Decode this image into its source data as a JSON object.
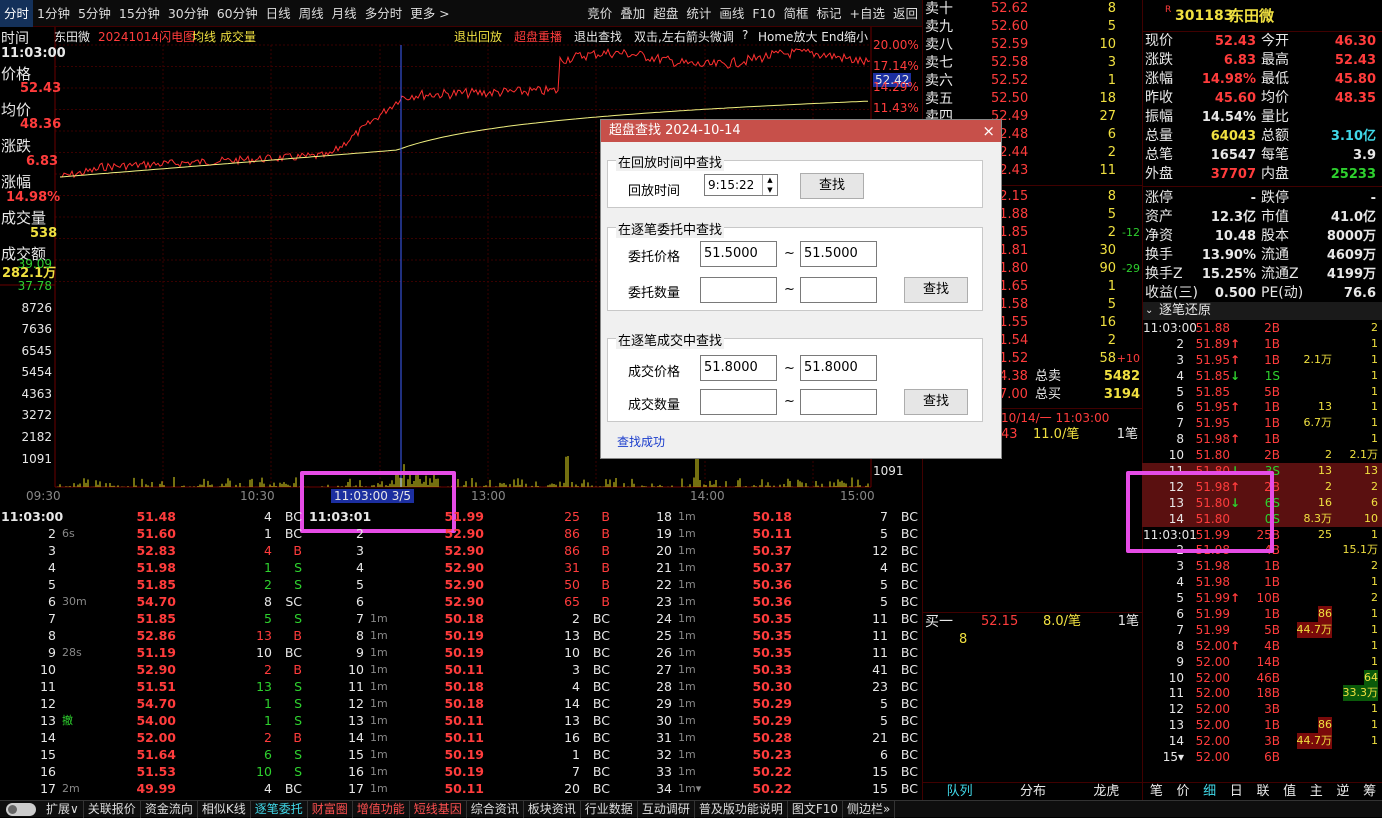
{
  "topbar": {
    "left": [
      "分时",
      "1分钟",
      "5分钟",
      "15分钟",
      "30分钟",
      "60分钟",
      "日线",
      "周线",
      "月线",
      "多分时",
      "更多 >"
    ],
    "right": [
      "竞价",
      "叠加",
      "超盘",
      "统计",
      "画线",
      "F10",
      "简框",
      "标记",
      "+自选",
      "返回"
    ]
  },
  "chart": {
    "name": "东田微",
    "title_date": "20241014闪电图",
    "legend": [
      "均线",
      "成交量"
    ],
    "actions": [
      "退出回放",
      "超盘重播",
      "退出查找",
      "双击,左右箭头微调",
      "?",
      "Home放大 End缩小"
    ],
    "side": {
      "time_label": "时间",
      "time": "11:03:00",
      "price_label": "价格",
      "price": "52.43",
      "avg_label": "均价",
      "avg": "48.36",
      "chg_label": "涨跌",
      "chg": "6.83",
      "pct_label": "涨幅",
      "pct": "14.98%",
      "vol_label": "成交量",
      "vol": "538",
      "amt_label": "成交额",
      "amt": "282.1万"
    },
    "left_axis": [
      "39.09",
      "37.78",
      "8726",
      "7636",
      "6545",
      "5454",
      "4363",
      "3272",
      "2182",
      "1091"
    ],
    "right_axis": [
      "20.00%",
      "17.14%",
      "52.42",
      "14.29%",
      "11.43%"
    ],
    "vol_right": "1091",
    "x_ticks": [
      "09:30",
      "10:30",
      "13:00",
      "14:00",
      "15:00"
    ],
    "cursor_label": "11:03:00 3/5",
    "colors": {
      "price": "#ff3030",
      "avg": "#f0f080",
      "vol": "#e8e020",
      "cursor": "#4060ff"
    }
  },
  "trades": {
    "col1": [
      [
        "11:03:00",
        "",
        "51.48",
        "4",
        "BC"
      ],
      [
        "2",
        "6s",
        "51.60",
        "1",
        "BC"
      ],
      [
        "3",
        "",
        "52.83",
        "4",
        "B"
      ],
      [
        "4",
        "",
        "51.98",
        "1",
        "S"
      ],
      [
        "5",
        "",
        "51.85",
        "2",
        "S"
      ],
      [
        "6",
        "30m",
        "54.70",
        "8",
        "SC"
      ],
      [
        "7",
        "",
        "51.85",
        "5",
        "S"
      ],
      [
        "8",
        "",
        "52.86",
        "13",
        "B"
      ],
      [
        "9",
        "28s",
        "51.19",
        "10",
        "BC"
      ],
      [
        "10",
        "",
        "52.90",
        "2",
        "B"
      ],
      [
        "11",
        "",
        "51.51",
        "13",
        "S"
      ],
      [
        "12",
        "",
        "54.70",
        "1",
        "S"
      ],
      [
        "13",
        "撤",
        "54.00",
        "1",
        "S"
      ],
      [
        "14",
        "",
        "52.00",
        "2",
        "B"
      ],
      [
        "15",
        "",
        "51.64",
        "6",
        "S"
      ],
      [
        "16",
        "",
        "51.53",
        "10",
        "S"
      ],
      [
        "17",
        "2m",
        "49.99",
        "4",
        "BC"
      ]
    ],
    "col2": [
      [
        "11:03:01",
        "",
        "51.99",
        "25",
        "B"
      ],
      [
        "2",
        "",
        "52.90",
        "86",
        "B"
      ],
      [
        "3",
        "",
        "52.90",
        "86",
        "B"
      ],
      [
        "4",
        "",
        "52.90",
        "31",
        "B"
      ],
      [
        "5",
        "",
        "52.90",
        "50",
        "B"
      ],
      [
        "6",
        "",
        "52.90",
        "65",
        "B"
      ],
      [
        "7",
        "1m",
        "50.18",
        "2",
        "BC"
      ],
      [
        "8",
        "1m",
        "50.19",
        "13",
        "BC"
      ],
      [
        "9",
        "1m",
        "50.19",
        "10",
        "BC"
      ],
      [
        "10",
        "1m",
        "50.11",
        "3",
        "BC"
      ],
      [
        "11",
        "1m",
        "50.18",
        "4",
        "BC"
      ],
      [
        "12",
        "1m",
        "50.18",
        "14",
        "BC"
      ],
      [
        "13",
        "1m",
        "50.11",
        "13",
        "BC"
      ],
      [
        "14",
        "1m",
        "50.11",
        "16",
        "BC"
      ],
      [
        "15",
        "1m",
        "50.19",
        "1",
        "BC"
      ],
      [
        "16",
        "1m",
        "50.19",
        "7",
        "BC"
      ],
      [
        "17",
        "1m",
        "50.11",
        "20",
        "BC"
      ]
    ],
    "col3": [
      [
        "18",
        "1m",
        "50.18",
        "7",
        "BC"
      ],
      [
        "19",
        "1m",
        "50.11",
        "5",
        "BC"
      ],
      [
        "20",
        "1m",
        "50.37",
        "12",
        "BC"
      ],
      [
        "21",
        "1m",
        "50.37",
        "4",
        "BC"
      ],
      [
        "22",
        "1m",
        "50.36",
        "5",
        "BC"
      ],
      [
        "23",
        "1m",
        "50.36",
        "5",
        "BC"
      ],
      [
        "24",
        "1m",
        "50.35",
        "11",
        "BC"
      ],
      [
        "25",
        "1m",
        "50.35",
        "11",
        "BC"
      ],
      [
        "26",
        "1m",
        "50.35",
        "11",
        "BC"
      ],
      [
        "27",
        "1m",
        "50.33",
        "41",
        "BC"
      ],
      [
        "28",
        "1m",
        "50.30",
        "23",
        "BC"
      ],
      [
        "29",
        "1m",
        "50.29",
        "5",
        "BC"
      ],
      [
        "30",
        "1m",
        "50.29",
        "5",
        "BC"
      ],
      [
        "31",
        "1m",
        "50.28",
        "21",
        "BC"
      ],
      [
        "32",
        "1m",
        "50.23",
        "6",
        "BC"
      ],
      [
        "33",
        "1m",
        "50.22",
        "15",
        "BC"
      ],
      [
        "34",
        "1m▾",
        "50.22",
        "15",
        "BC"
      ]
    ]
  },
  "orderbook": {
    "sells": [
      [
        "卖十",
        "52.62",
        "8"
      ],
      [
        "卖九",
        "52.60",
        "5"
      ],
      [
        "卖八",
        "52.59",
        "10"
      ],
      [
        "卖七",
        "52.58",
        "3"
      ],
      [
        "卖六",
        "52.52",
        "1"
      ],
      [
        "卖五",
        "52.50",
        "18"
      ],
      [
        "卖四",
        "52.49",
        "27"
      ],
      [
        "",
        "52.48",
        "6"
      ],
      [
        "",
        "52.44",
        "2"
      ],
      [
        "",
        "52.43",
        "11"
      ]
    ],
    "buys": [
      [
        "",
        "52.15",
        "8",
        ""
      ],
      [
        "",
        "51.88",
        "5",
        ""
      ],
      [
        "",
        "51.85",
        "2",
        "-12"
      ],
      [
        "",
        "51.81",
        "30",
        ""
      ],
      [
        "",
        "51.80",
        "90",
        "-29"
      ],
      [
        "",
        "51.65",
        "1",
        ""
      ],
      [
        "",
        "51.58",
        "5",
        ""
      ],
      [
        "",
        "51.55",
        "16",
        ""
      ],
      [
        "",
        "51.54",
        "2",
        ""
      ],
      [
        "",
        "51.52",
        "58",
        "+10"
      ]
    ],
    "total_sell_label": "总卖",
    "total_sell": "5482",
    "total_buy_label": "总买",
    "total_buy": "3194",
    "left_a": "4.38",
    "left_b": "7.00",
    "date": "10/14/一 11:03:00",
    "last": {
      "price": "43",
      "qty": "11.0/笔",
      "n": "1笔"
    },
    "bid1": {
      "label": "买一",
      "price": "52.15",
      "qty": "8.0/笔",
      "n": "1笔",
      "vol": "8"
    },
    "tabs": [
      "队列",
      "分布",
      "龙虎"
    ]
  },
  "info": {
    "code": "301183",
    "name": "东田微",
    "badge": "R",
    "rows": [
      [
        "现价",
        "52.43",
        "今开",
        "46.30"
      ],
      [
        "涨跌",
        "6.83",
        "最高",
        "52.43"
      ],
      [
        "涨幅",
        "14.98%",
        "最低",
        "45.80"
      ],
      [
        "昨收",
        "45.60",
        "均价",
        "48.35"
      ],
      [
        "振幅",
        "14.54%",
        "量比",
        ""
      ],
      [
        "总量",
        "64043",
        "总额",
        "3.10亿"
      ],
      [
        "总笔",
        "16547",
        "每笔",
        "3.9"
      ],
      [
        "外盘",
        "37707",
        "内盘",
        "25233"
      ]
    ],
    "rows2": [
      [
        "涨停",
        "-",
        "跌停",
        "-"
      ],
      [
        "资产",
        "12.3亿",
        "市值",
        "41.0亿"
      ],
      [
        "净资",
        "10.48",
        "股本",
        "8000万"
      ],
      [
        "换手",
        "13.90%",
        "流通",
        "4609万"
      ],
      [
        "换手Z",
        "15.25%",
        "流通Z",
        "4199万"
      ],
      [
        "收益(三)",
        "0.500",
        "PE(动)",
        "76.6"
      ]
    ],
    "tick_header": "逐笔还原",
    "ticks": [
      [
        "11:03:00",
        "51.88",
        "",
        "2B",
        "",
        "2"
      ],
      [
        "2",
        "51.89",
        "up",
        "1B",
        "",
        "1"
      ],
      [
        "3",
        "51.95",
        "up",
        "1B",
        "2.1万",
        "1"
      ],
      [
        "4",
        "51.85",
        "dn",
        "1S",
        "",
        "1"
      ],
      [
        "5",
        "51.85",
        "",
        "5B",
        "",
        "1"
      ],
      [
        "6",
        "51.95",
        "up",
        "1B",
        "13",
        "1"
      ],
      [
        "7",
        "51.95",
        "",
        "1B",
        "6.7万",
        "1"
      ],
      [
        "8",
        "51.98",
        "up",
        "1B",
        "",
        "1"
      ],
      [
        "10",
        "51.80",
        "",
        "2B",
        "2",
        "2.1万"
      ],
      [
        "11",
        "51.80",
        "dn",
        "3S",
        "13",
        "13"
      ],
      [
        "12",
        "51.98",
        "up",
        "2B",
        "2",
        "2"
      ],
      [
        "13",
        "51.80",
        "dn",
        "6S",
        "16",
        "6"
      ],
      [
        "14",
        "51.80",
        "",
        "0S",
        "8.3万",
        "10"
      ],
      [
        "11:03:01",
        "51.99",
        "",
        "25B",
        "25",
        "1"
      ],
      [
        "2",
        "51.98",
        "",
        "4B",
        "",
        "15.1万"
      ],
      [
        "3",
        "51.98",
        "",
        "1B",
        "",
        "2"
      ],
      [
        "4",
        "51.98",
        "",
        "1B",
        "",
        "1"
      ],
      [
        "5",
        "51.99",
        "up",
        "10B",
        "",
        "2"
      ],
      [
        "6",
        "51.99",
        "",
        "1B",
        "86",
        "1"
      ],
      [
        "7",
        "51.99",
        "",
        "5B",
        "44.7万",
        "1"
      ],
      [
        "8",
        "52.00",
        "up",
        "4B",
        "",
        "1"
      ],
      [
        "9",
        "52.00",
        "",
        "14B",
        "",
        "1"
      ],
      [
        "10",
        "52.00",
        "",
        "46B",
        "",
        "64"
      ],
      [
        "11",
        "52.00",
        "",
        "18B",
        "",
        "33.3万"
      ],
      [
        "12",
        "52.00",
        "",
        "3B",
        "",
        "1"
      ],
      [
        "13",
        "52.00",
        "",
        "1B",
        "86",
        "1"
      ],
      [
        "14",
        "52.00",
        "",
        "3B",
        "44.7万",
        "1"
      ],
      [
        "15▾",
        "52.00",
        "",
        "6B",
        "",
        ""
      ]
    ],
    "tabs": [
      "笔",
      "价",
      "细",
      "日",
      "联",
      "值",
      "主",
      "逆",
      "筹"
    ]
  },
  "bottombar": [
    "扩展∨",
    "关联报价",
    "资金流向",
    "相似K线",
    "逐笔委托",
    "财富圈",
    "增值功能",
    "短线基因",
    "综合资讯",
    "板块资讯",
    "行业数据",
    "互动调研",
    "普及版功能说明",
    "图文F10",
    "侧边栏»"
  ],
  "dialog": {
    "title": "超盘查找 2024-10-14",
    "close": "×",
    "g1": {
      "title": "在回放时间中查找",
      "time_label": "回放时间",
      "time": "9:15:22",
      "btn": "查找"
    },
    "g2": {
      "title": "在逐笔委托中查找",
      "price_label": "委托价格",
      "p1": "51.5000",
      "p2": "51.5000",
      "qty_label": "委托数量",
      "btn": "查找"
    },
    "g3": {
      "title": "在逐笔成交中查找",
      "price_label": "成交价格",
      "p1": "51.8000",
      "p2": "51.8000",
      "qty_label": "成交数量",
      "btn": "查找"
    },
    "tilde": "~",
    "status": "查找成功"
  }
}
